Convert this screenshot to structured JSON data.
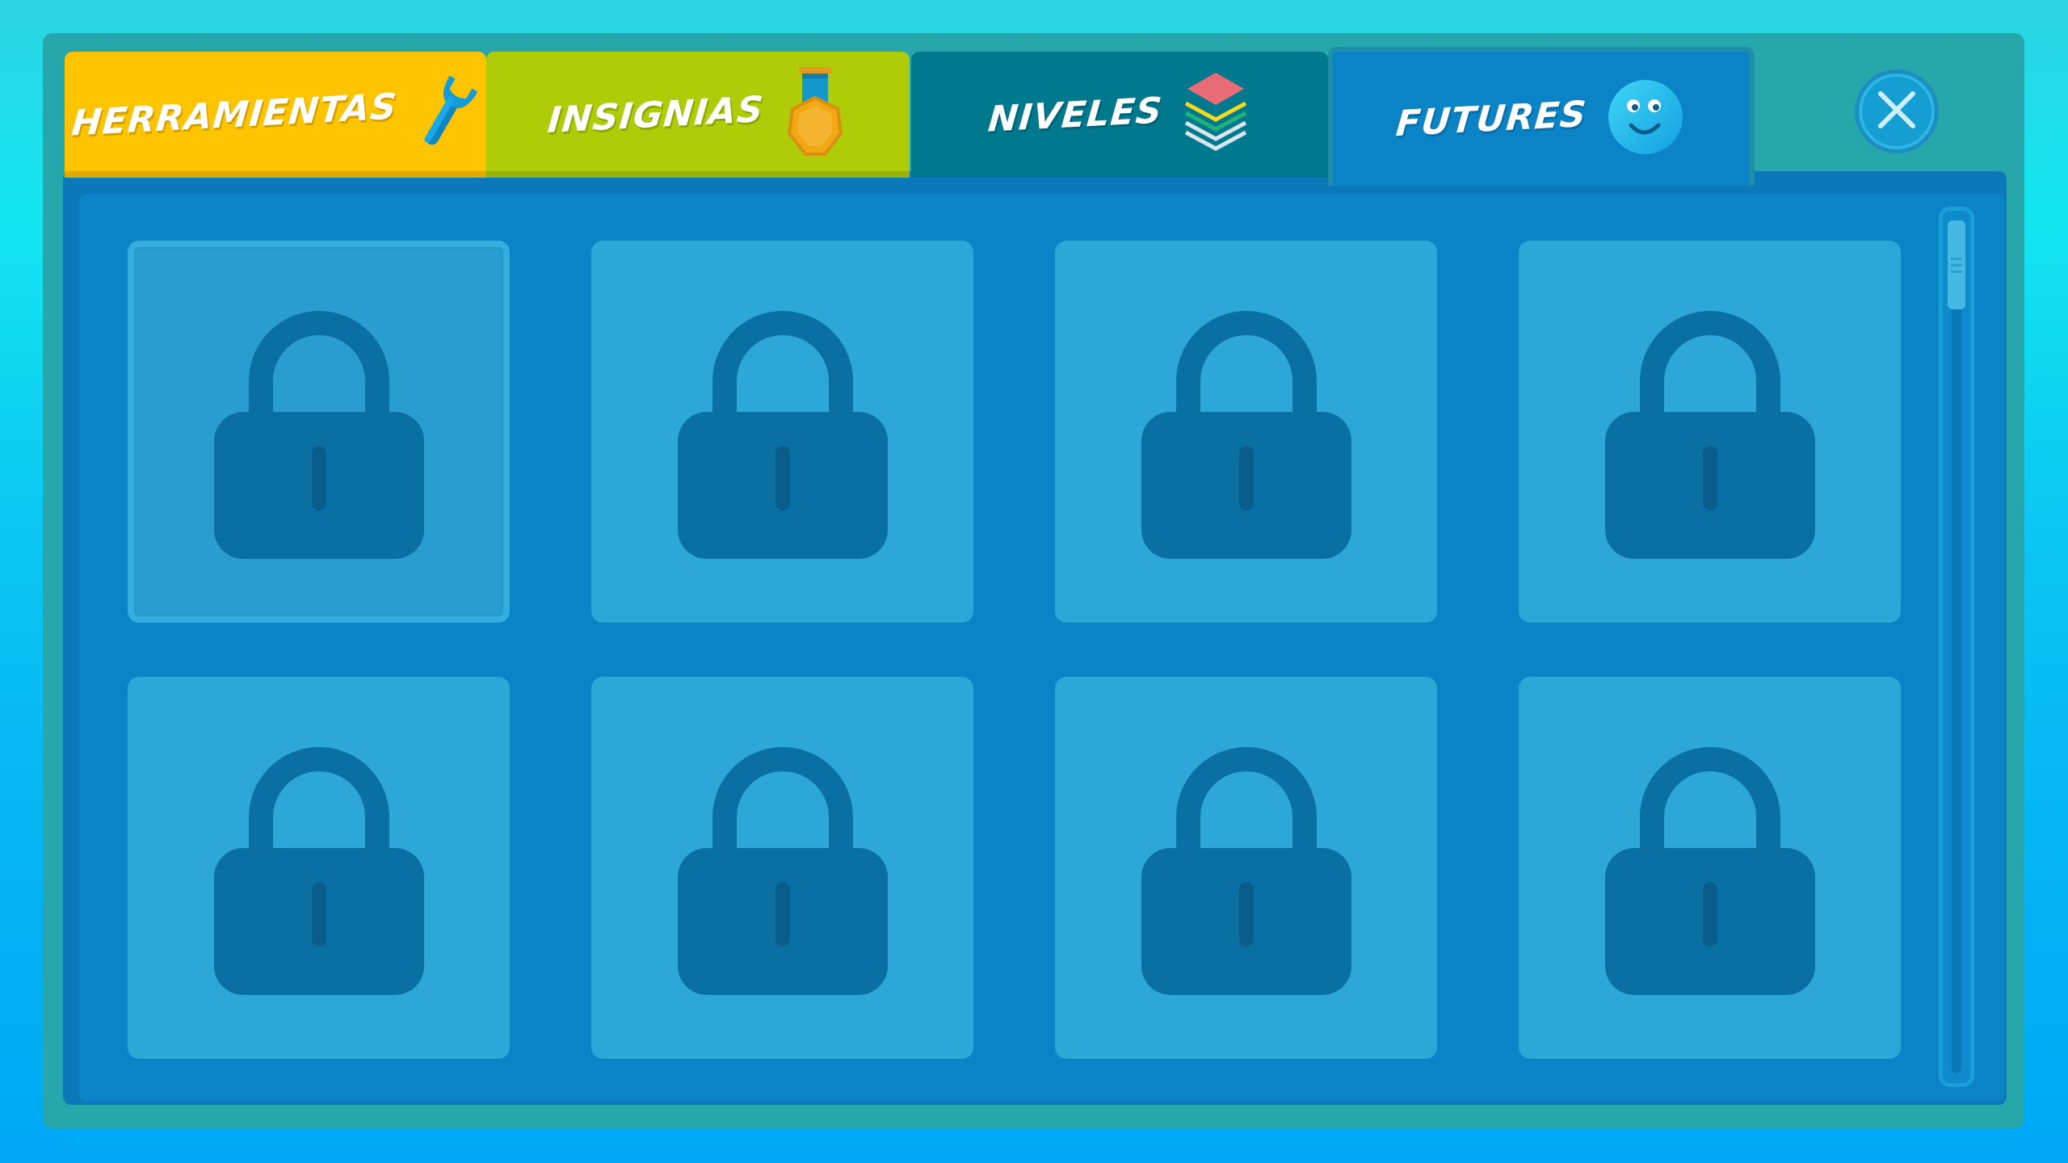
{
  "tabs": [
    {
      "id": "herramientas",
      "label": "HERRAMIENTAS",
      "icon": "wrench-icon",
      "color": "#fec400",
      "active": false
    },
    {
      "id": "insignias",
      "label": "INSIGNIAS",
      "icon": "medal-icon",
      "color": "#b0cb08",
      "active": false
    },
    {
      "id": "niveles",
      "label": "NIVELES",
      "icon": "layers-icon",
      "color": "#00788d",
      "active": false
    },
    {
      "id": "futures",
      "label": "FUTURES",
      "icon": "smiley-icon",
      "color": "#0b84c7",
      "active": true
    }
  ],
  "close_button": {
    "icon": "close-icon"
  },
  "grid": {
    "columns": 4,
    "rows_visible": 2,
    "items": [
      {
        "state": "locked",
        "icon": "lock-icon",
        "selected": true
      },
      {
        "state": "locked",
        "icon": "lock-icon",
        "selected": false
      },
      {
        "state": "locked",
        "icon": "lock-icon",
        "selected": false
      },
      {
        "state": "locked",
        "icon": "lock-icon",
        "selected": false
      },
      {
        "state": "locked",
        "icon": "lock-icon",
        "selected": false
      },
      {
        "state": "locked",
        "icon": "lock-icon",
        "selected": false
      },
      {
        "state": "locked",
        "icon": "lock-icon",
        "selected": false
      },
      {
        "state": "locked",
        "icon": "lock-icon",
        "selected": false
      }
    ]
  },
  "scrollbar": {
    "position": 0.0
  },
  "colors": {
    "frame": "#27a7ac",
    "panel": "#0b84c7",
    "cell": "#2da6d8",
    "lock": "#0a6fa3"
  }
}
